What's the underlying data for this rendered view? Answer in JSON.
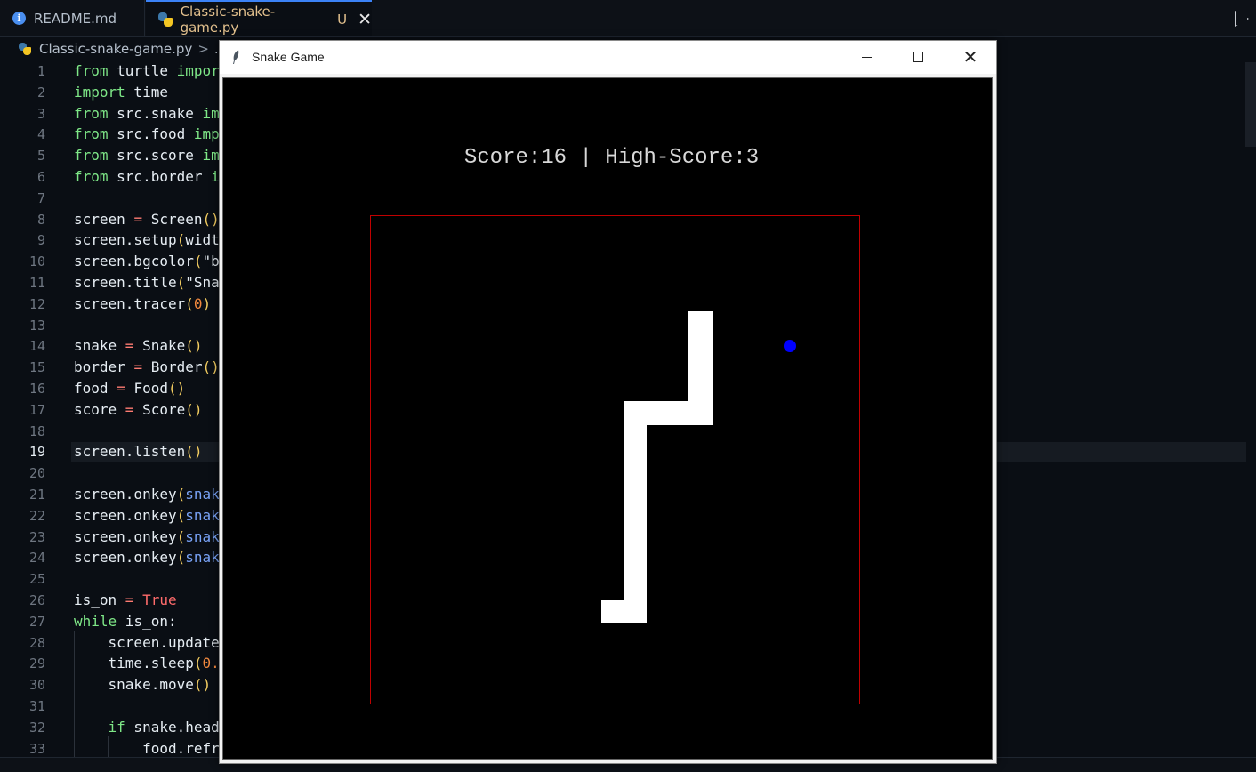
{
  "tabs": [
    {
      "label": "README.md",
      "icon": "info-icon",
      "active": false
    },
    {
      "label": "Classic-snake-game.py",
      "badge": "U",
      "icon": "python-icon",
      "active": true,
      "close": "✕"
    }
  ],
  "breadcrumb": {
    "file": "Classic-snake-game.py",
    "sep": ">",
    "more": "..."
  },
  "editor": {
    "active_line": 19,
    "line_numbers": [
      "1",
      "2",
      "3",
      "4",
      "5",
      "6",
      "7",
      "8",
      "9",
      "10",
      "11",
      "12",
      "13",
      "14",
      "15",
      "16",
      "17",
      "18",
      "19",
      "20",
      "21",
      "22",
      "23",
      "24",
      "25",
      "26",
      "27",
      "28",
      "29",
      "30",
      "31",
      "32",
      "33"
    ],
    "lines": [
      [
        {
          "t": "from",
          "c": "kw"
        },
        {
          "t": " turtle ",
          "c": "tx"
        },
        {
          "t": "impor",
          "c": "kw"
        }
      ],
      [
        {
          "t": "import",
          "c": "kw"
        },
        {
          "t": " time",
          "c": "tx"
        }
      ],
      [
        {
          "t": "from",
          "c": "kw"
        },
        {
          "t": " src.snake ",
          "c": "tx"
        },
        {
          "t": "im",
          "c": "kw"
        }
      ],
      [
        {
          "t": "from",
          "c": "kw"
        },
        {
          "t": " src.food ",
          "c": "tx"
        },
        {
          "t": "imp",
          "c": "kw"
        }
      ],
      [
        {
          "t": "from",
          "c": "kw"
        },
        {
          "t": " src.score ",
          "c": "tx"
        },
        {
          "t": "im",
          "c": "kw"
        }
      ],
      [
        {
          "t": "from",
          "c": "kw"
        },
        {
          "t": " src.border ",
          "c": "tx"
        },
        {
          "t": "i",
          "c": "kw"
        }
      ],
      [],
      [
        {
          "t": "screen ",
          "c": "tx"
        },
        {
          "t": "=",
          "c": "op"
        },
        {
          "t": " Screen",
          "c": "tx"
        },
        {
          "t": "()",
          "c": "pn"
        }
      ],
      [
        {
          "t": "screen.setup",
          "c": "tx"
        },
        {
          "t": "(",
          "c": "pn"
        },
        {
          "t": "widt",
          "c": "tx"
        }
      ],
      [
        {
          "t": "screen.bgcolor",
          "c": "tx"
        },
        {
          "t": "(",
          "c": "pn"
        },
        {
          "t": "\"b",
          "c": "tx"
        }
      ],
      [
        {
          "t": "screen.title",
          "c": "tx"
        },
        {
          "t": "(",
          "c": "pn"
        },
        {
          "t": "\"Sna",
          "c": "tx"
        }
      ],
      [
        {
          "t": "screen.tracer",
          "c": "tx"
        },
        {
          "t": "(",
          "c": "pn"
        },
        {
          "t": "0",
          "c": "nm"
        },
        {
          "t": ")",
          "c": "pn"
        }
      ],
      [],
      [
        {
          "t": "snake ",
          "c": "tx"
        },
        {
          "t": "=",
          "c": "op"
        },
        {
          "t": " Snake",
          "c": "tx"
        },
        {
          "t": "()",
          "c": "pn"
        }
      ],
      [
        {
          "t": "border ",
          "c": "tx"
        },
        {
          "t": "=",
          "c": "op"
        },
        {
          "t": " Border",
          "c": "tx"
        },
        {
          "t": "()",
          "c": "pn"
        }
      ],
      [
        {
          "t": "food ",
          "c": "tx"
        },
        {
          "t": "=",
          "c": "op"
        },
        {
          "t": " Food",
          "c": "tx"
        },
        {
          "t": "()",
          "c": "pn"
        }
      ],
      [
        {
          "t": "score ",
          "c": "tx"
        },
        {
          "t": "=",
          "c": "op"
        },
        {
          "t": " Score",
          "c": "tx"
        },
        {
          "t": "()",
          "c": "pn"
        }
      ],
      [],
      [
        {
          "t": "screen.listen",
          "c": "tx"
        },
        {
          "t": "()",
          "c": "pn"
        }
      ],
      [],
      [
        {
          "t": "screen.onkey",
          "c": "tx"
        },
        {
          "t": "(",
          "c": "pn"
        },
        {
          "t": "snak",
          "c": "vr"
        }
      ],
      [
        {
          "t": "screen.onkey",
          "c": "tx"
        },
        {
          "t": "(",
          "c": "pn"
        },
        {
          "t": "snak",
          "c": "vr"
        }
      ],
      [
        {
          "t": "screen.onkey",
          "c": "tx"
        },
        {
          "t": "(",
          "c": "pn"
        },
        {
          "t": "snak",
          "c": "vr"
        }
      ],
      [
        {
          "t": "screen.onkey",
          "c": "tx"
        },
        {
          "t": "(",
          "c": "pn"
        },
        {
          "t": "snak",
          "c": "vr"
        }
      ],
      [],
      [
        {
          "t": "is_on ",
          "c": "tx"
        },
        {
          "t": "=",
          "c": "op"
        },
        {
          "t": " ",
          "c": "tx"
        },
        {
          "t": "True",
          "c": "bl"
        }
      ],
      [
        {
          "t": "while",
          "c": "kw"
        },
        {
          "t": " is_on:",
          "c": "tx"
        }
      ],
      [
        {
          "t": "    screen.update",
          "c": "tx"
        }
      ],
      [
        {
          "t": "    time.sleep",
          "c": "tx"
        },
        {
          "t": "(",
          "c": "pn"
        },
        {
          "t": "0.",
          "c": "nm"
        }
      ],
      [
        {
          "t": "    snake.move",
          "c": "tx"
        },
        {
          "t": "()",
          "c": "pn"
        }
      ],
      [],
      [
        {
          "t": "    ",
          "c": "tx"
        },
        {
          "t": "if",
          "c": "kw"
        },
        {
          "t": " snake.head",
          "c": "tx"
        }
      ],
      [
        {
          "t": "        food.refr",
          "c": "tx"
        }
      ]
    ]
  },
  "colors": {
    "kw": "#7ee787",
    "tx": "#e6edf3",
    "op": "#ff7b72",
    "pn": "#f2cc60",
    "nm": "#f0883e",
    "vr": "#79a3f7",
    "bl": "#ff6b6b"
  },
  "game_window": {
    "title": "Snake Game",
    "icon": "feather-icon",
    "minimize": "minimize-icon",
    "maximize": "maximize-icon",
    "close": "✕",
    "score_text": "Score:16 | High-Score:3",
    "score": 16,
    "high_score": 3,
    "border_color": "#c00000",
    "snake_color": "#ffffff",
    "food_color": "#0000ff"
  }
}
